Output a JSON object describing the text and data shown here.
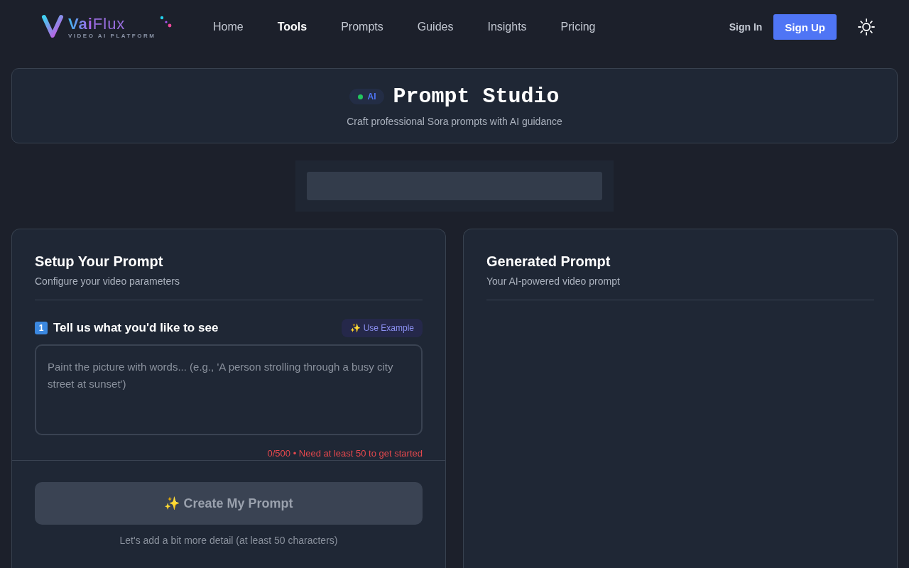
{
  "brand": {
    "name": "**Vai**Flux",
    "tagline": "VIDEO AI PLATFORM"
  },
  "nav": [
    {
      "label": "Home",
      "selected": false
    },
    {
      "label": "Tools",
      "selected": true
    },
    {
      "label": "Prompts",
      "selected": false
    },
    {
      "label": "Guides",
      "selected": false
    },
    {
      "label": "Insights",
      "selected": false
    },
    {
      "label": "Pricing",
      "selected": false
    }
  ],
  "auth": {
    "sign_in": "Sign In",
    "sign_up": "Sign Up"
  },
  "hero": {
    "badge": "AI",
    "title": "Prompt Studio",
    "subtitle": "Craft professional Sora prompts with AI guidance"
  },
  "setup": {
    "title": "Setup Your Prompt",
    "subtitle": "Configure your video parameters",
    "step_number": "1",
    "step_label": "Tell us what you'd like to see",
    "example_icon": "✨",
    "example_button": "Use Example",
    "placeholder": "Paint the picture with words... (e.g., 'A person strolling through a busy city street at sunset')",
    "counter": "0/500 • Need at least 50 to get started",
    "create_icon": "✨",
    "create_button": "Create My Prompt",
    "create_disabled": true,
    "hint": "Let's add a bit more detail (at least 50 characters)"
  },
  "output": {
    "title": "Generated Prompt",
    "subtitle": "Your AI-powered video prompt"
  }
}
